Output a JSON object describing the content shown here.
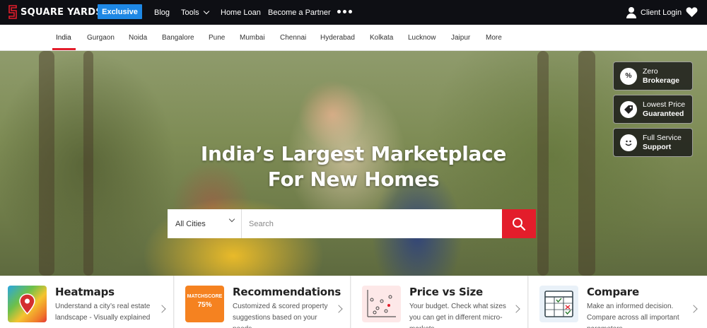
{
  "brand": {
    "name": "SQUARE YARDS",
    "accent": "#e31d2b",
    "blue": "#1e88e5"
  },
  "topnav": {
    "exclusive": "Exclusive",
    "items": [
      "Blog",
      "Tools",
      "Home Loan",
      "Become a Partner"
    ],
    "more_icon": "more-dots-icon",
    "client_login": "Client Login",
    "wishlist_icon": "heart-icon"
  },
  "cities": {
    "items": [
      "India",
      "Gurgaon",
      "Noida",
      "Bangalore",
      "Pune",
      "Mumbai",
      "Chennai",
      "Hyderabad",
      "Kolkata",
      "Lucknow",
      "Jaipur",
      "More"
    ],
    "active": "India"
  },
  "hero": {
    "title_line1": "India’s Largest Marketplace",
    "title_line2": "For New Homes"
  },
  "search": {
    "city_value": "All Cities",
    "placeholder": "Search",
    "button_icon": "search-icon"
  },
  "badges": [
    {
      "icon": "percent-icon",
      "line1": "Zero",
      "line2": "Brokerage"
    },
    {
      "icon": "price-tag-icon",
      "line1": "Lowest Price",
      "line2": "Guaranteed"
    },
    {
      "icon": "smiley-icon",
      "line1": "Full Service",
      "line2": "Support"
    }
  ],
  "features": [
    {
      "title": "Heatmaps",
      "desc": "Understand a city’s real estate landscape - Visually explained",
      "icon": "heatmap-icon"
    },
    {
      "title": "Recommendations",
      "desc": "Customized & scored property suggestions based on your needs",
      "icon": "matchscore-icon",
      "icon_label": "MATCHSCORE",
      "icon_value": "75%"
    },
    {
      "title": "Price vs Size",
      "desc": "Your budget. Check what sizes you can get in different micro-markets",
      "icon": "scatter-plot-icon"
    },
    {
      "title": "Compare",
      "desc": "Make an informed decision. Compare across all important parameters",
      "icon": "compare-table-icon"
    }
  ]
}
